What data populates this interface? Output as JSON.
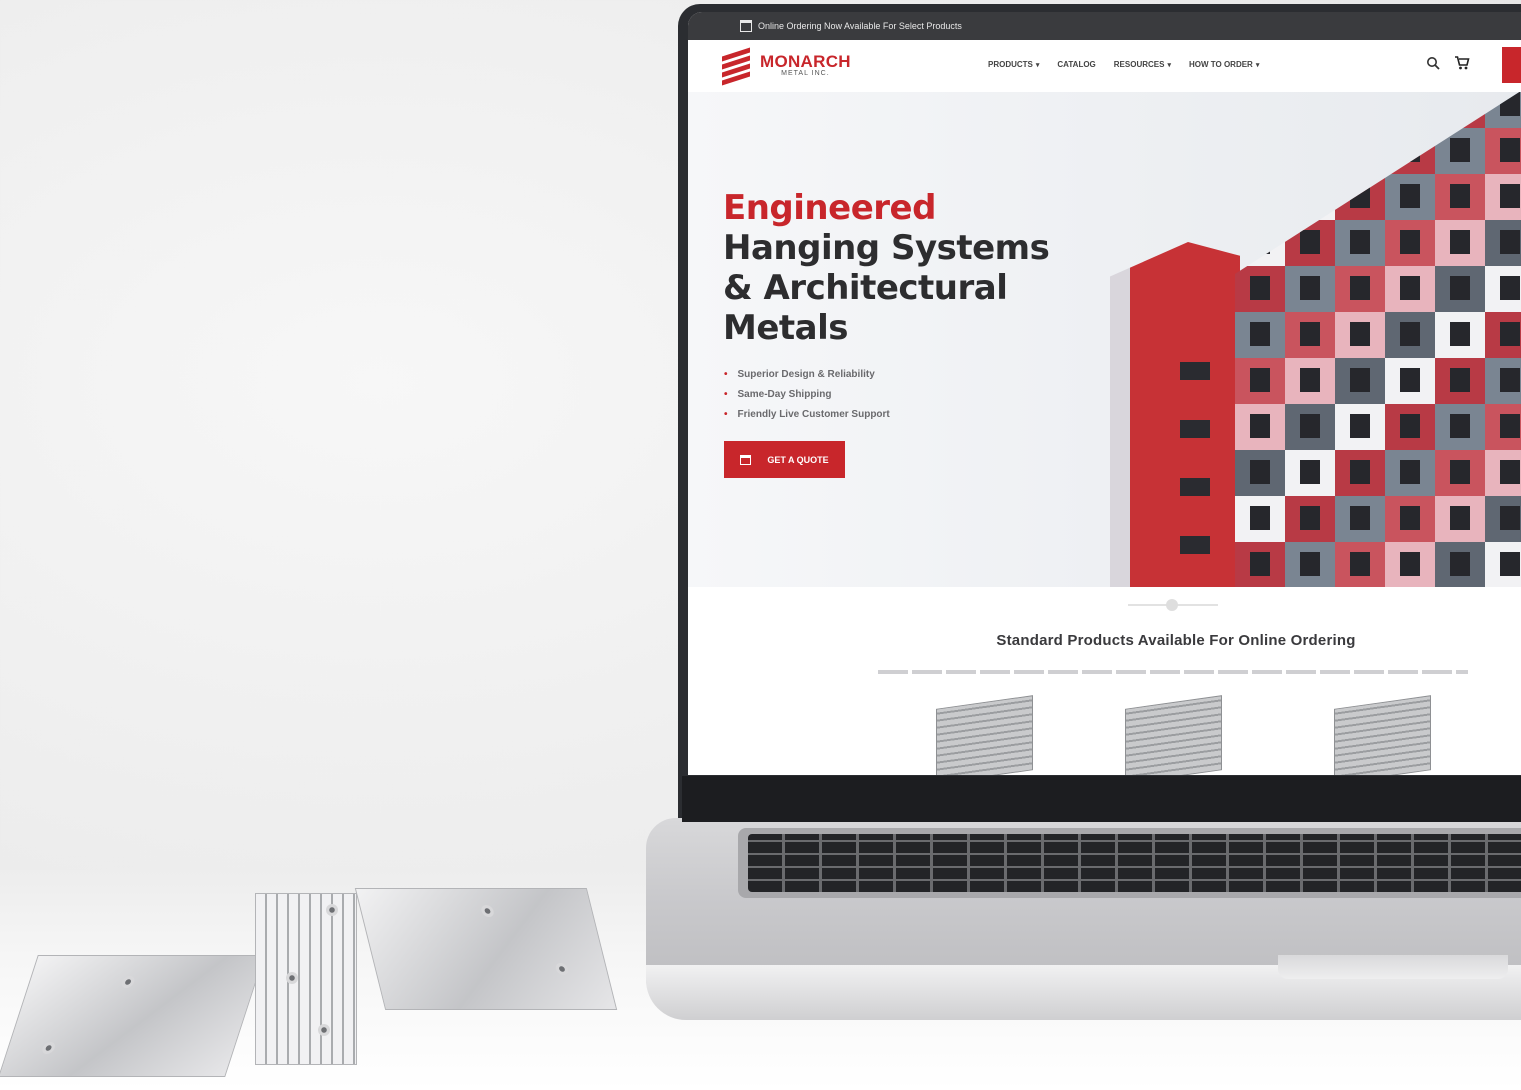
{
  "topbar": {
    "announcement": "Online Ordering Now Available For Select Products"
  },
  "brand": {
    "name": "MONARCH",
    "tagline": "METAL INC."
  },
  "nav": {
    "items": [
      {
        "label": "PRODUCTS",
        "dropdown": true
      },
      {
        "label": "CATALOG",
        "dropdown": false
      },
      {
        "label": "RESOURCES",
        "dropdown": true
      },
      {
        "label": "HOW TO ORDER",
        "dropdown": true
      }
    ],
    "caret": "▾",
    "search_icon": "search-icon",
    "cart_icon": "cart-icon"
  },
  "hero": {
    "title_red": "Engineered",
    "title_lines": [
      "Hanging Systems",
      "& Architectural",
      "Metals"
    ],
    "bullets": [
      "Superior Design & Reliability",
      "Same-Day Shipping",
      "Friendly Live Customer Support"
    ],
    "cta_label": "GET A QUOTE"
  },
  "products_section": {
    "title": "Standard Products Available For Online Ordering"
  },
  "colors": {
    "brand_red": "#c8262b",
    "dark": "#2d2d2f",
    "topbar": "#3a3b3e"
  }
}
